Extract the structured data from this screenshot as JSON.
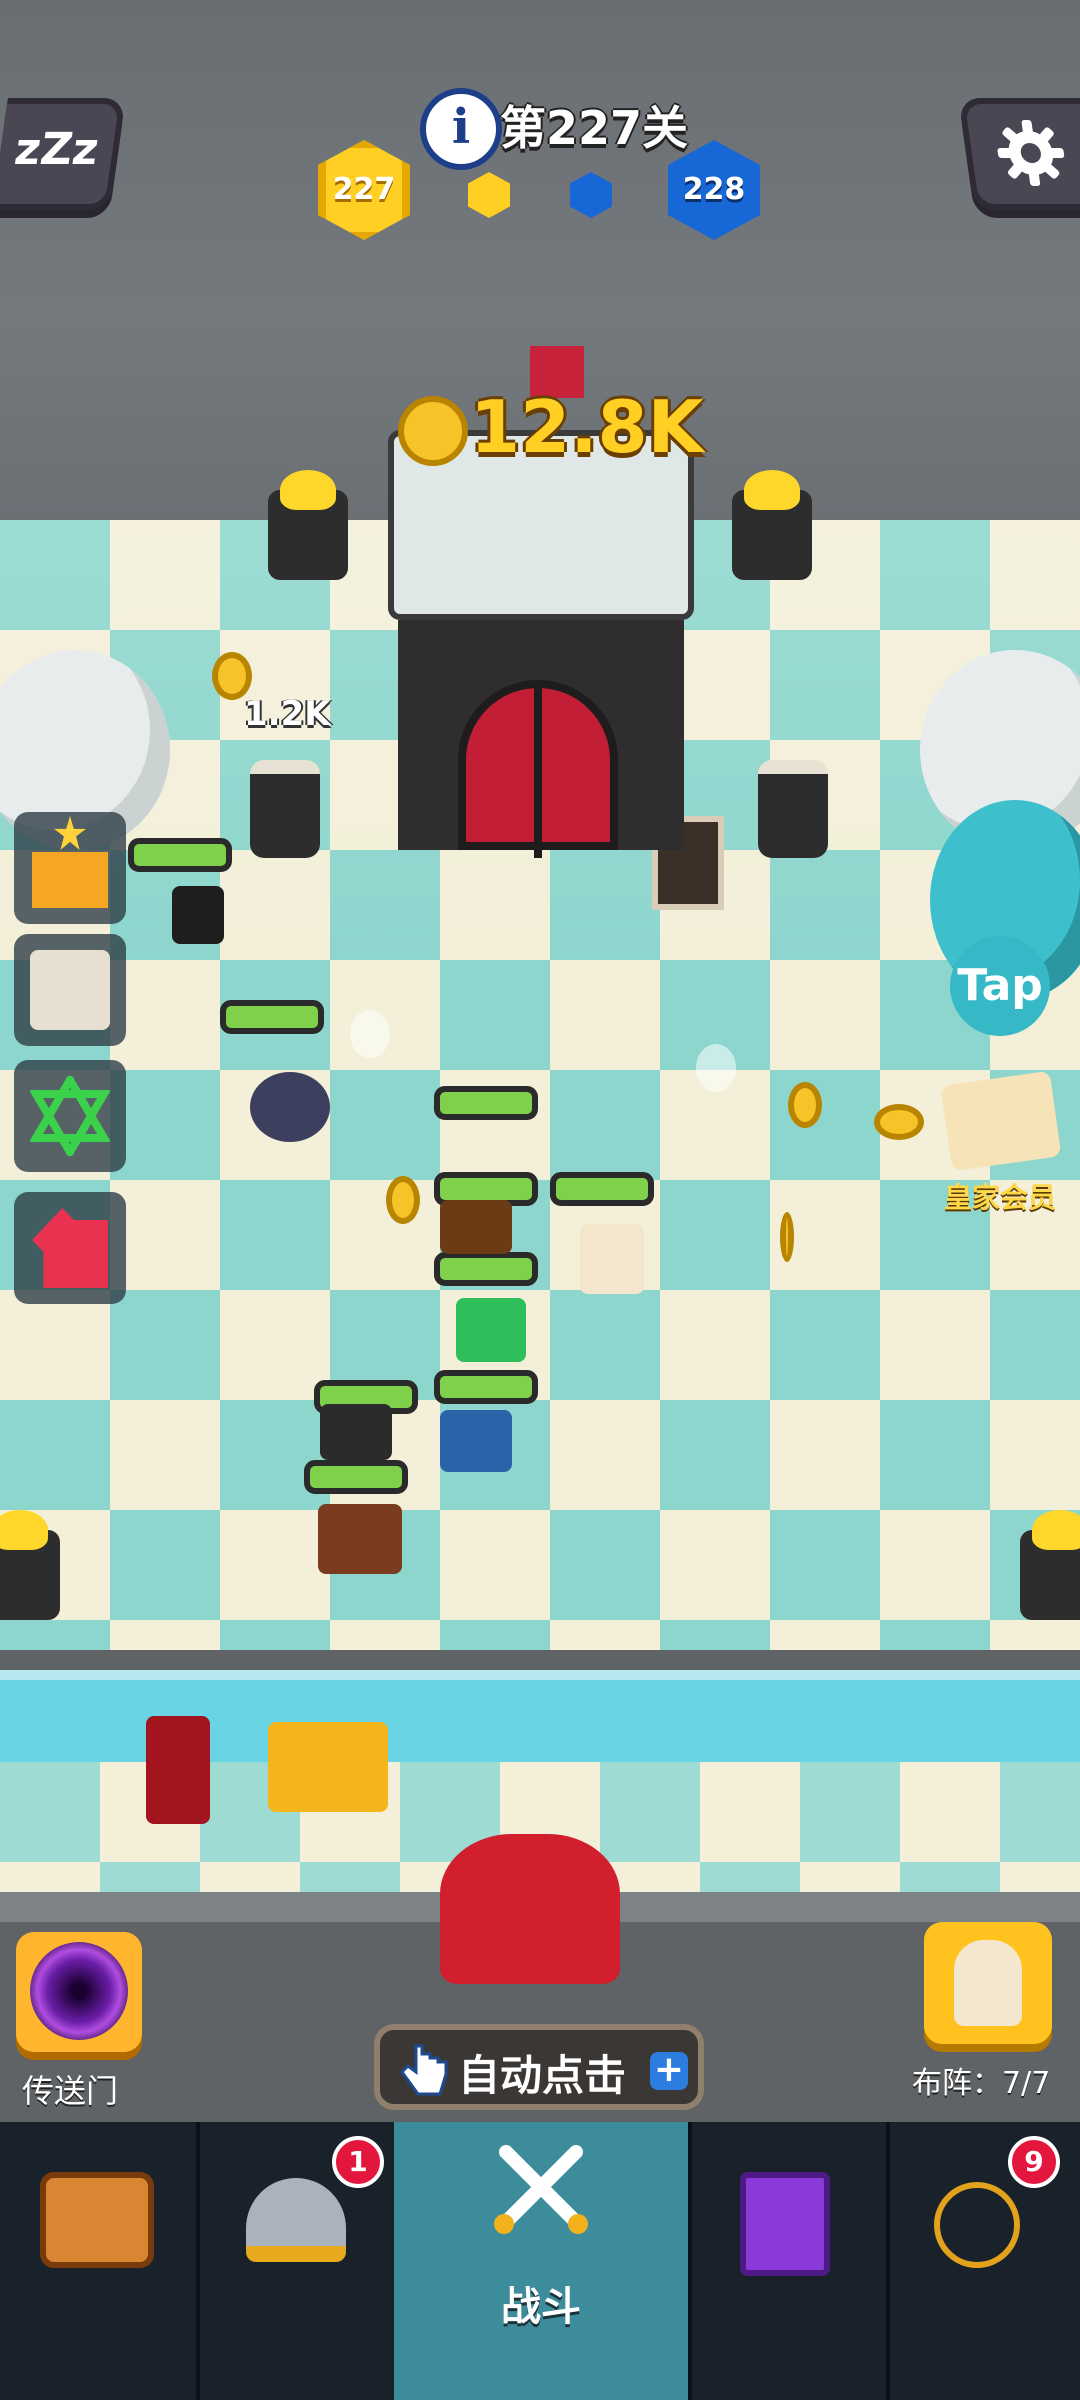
{
  "header": {
    "level_title": "第227关",
    "current_level": "227",
    "next_level": "228"
  },
  "battle": {
    "coin_total": "12.8K",
    "floating_reward": "1.2K",
    "tap_label": "Tap",
    "vip_label": "皇家会员"
  },
  "controls": {
    "portal_label": "传送门",
    "formation_label": "布阵：7/7",
    "auto_click_label": "自动点击",
    "auto_click_plus": "+"
  },
  "nav": {
    "battle_label": "战斗",
    "heroes_badge": "1",
    "items_badge": "9"
  },
  "colors": {
    "coin": "#f6c329",
    "player_level": "#ffcf24",
    "enemy_level": "#1767d6",
    "nav_active": "#3d8c9b"
  }
}
